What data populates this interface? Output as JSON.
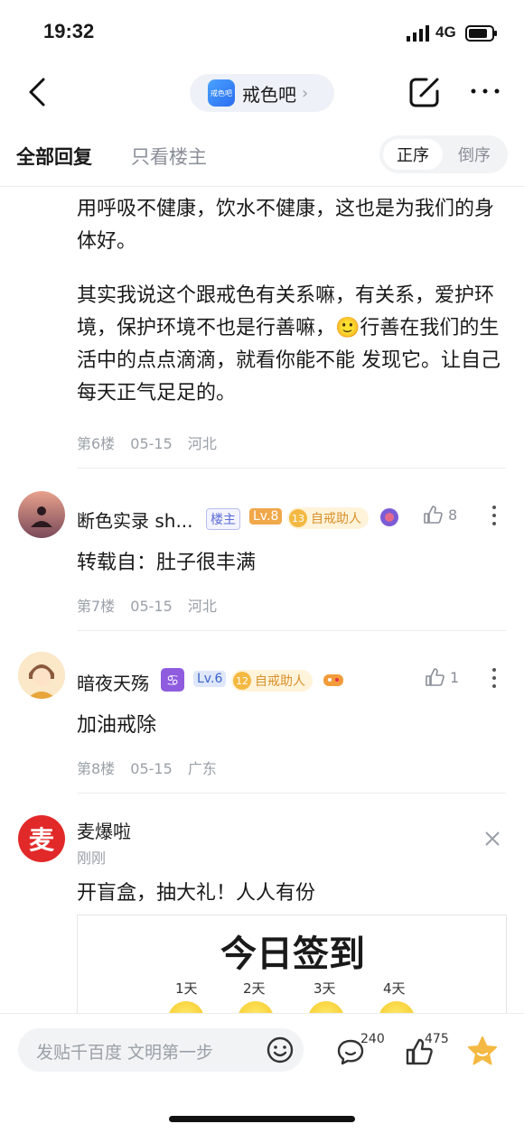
{
  "status": {
    "time": "19:32",
    "network": "4G"
  },
  "nav": {
    "forum_logo_text": "戒色吧",
    "forum_name": "戒色吧"
  },
  "tabs": {
    "all": "全部回复",
    "owner_only": "只看楼主",
    "sort_asc": "正序",
    "sort_desc": "倒序"
  },
  "post6": {
    "para1": "用呼吸不健康，饮水不健康，这也是为我们的身体好。",
    "para2": "其实我说这个跟戒色有关系嘛，有关系，爱护环境，保护环境不也是行善嘛，🙂行善在我们的生活中的点点滴滴，就看你能不能 发现它。让自己每天正气足足的。",
    "floor": "第6楼",
    "date": "05-15",
    "location": "河北"
  },
  "post7": {
    "user": "断色实录 sh...",
    "owner_badge": "楼主",
    "level": "Lv.8",
    "helper_level": "13",
    "helper_label": "自戒助人",
    "likes": "8",
    "text": "转载自：肚子很丰满",
    "floor": "第7楼",
    "date": "05-15",
    "location": "河北"
  },
  "post8": {
    "user": "暗夜天殇",
    "level": "Lv.6",
    "helper_level": "12",
    "helper_label": "自戒助人",
    "likes": "1",
    "text": "加油戒除",
    "floor": "第8楼",
    "date": "05-15",
    "location": "广东"
  },
  "ad": {
    "logo_text": "麦",
    "brand": "麦爆啦",
    "time": "刚刚",
    "text": "开盲盒，抽大礼！人人有份",
    "card_title": "今日签到",
    "days": [
      "1天",
      "2天",
      "3天",
      "4天"
    ]
  },
  "bottom": {
    "placeholder": "发贴千百度 文明第一步",
    "comment_count": "240",
    "like_count": "475"
  },
  "colors": {
    "accent": "#f4b942",
    "brand_red": "#e22929",
    "link_blue": "#2a6cf0"
  }
}
